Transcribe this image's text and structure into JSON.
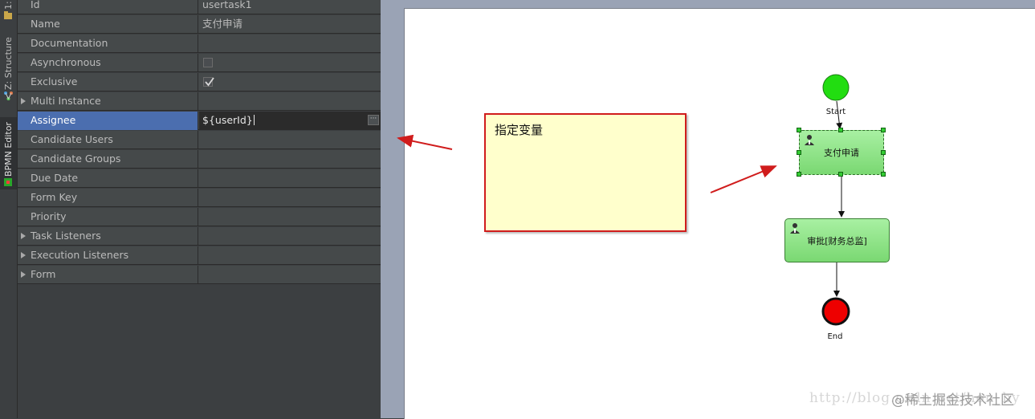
{
  "toolstrip": {
    "tabs": [
      {
        "label": "1:"
      },
      {
        "label": "Z: Structure"
      },
      {
        "label": "BPMN Editor"
      }
    ]
  },
  "properties": {
    "rows": [
      {
        "name": "Id",
        "value": "usertask1"
      },
      {
        "name": "Name",
        "value": "支付申请"
      },
      {
        "name": "Documentation",
        "value": ""
      },
      {
        "name": "Asynchronous",
        "value": ""
      },
      {
        "name": "Exclusive",
        "value": ""
      },
      {
        "name": "Multi Instance",
        "value": ""
      },
      {
        "name": "Assignee",
        "value": "${userId}"
      },
      {
        "name": "Candidate Users",
        "value": ""
      },
      {
        "name": "Candidate Groups",
        "value": ""
      },
      {
        "name": "Due Date",
        "value": ""
      },
      {
        "name": "Form Key",
        "value": ""
      },
      {
        "name": "Priority",
        "value": ""
      },
      {
        "name": "Task Listeners",
        "value": ""
      },
      {
        "name": "Execution Listeners",
        "value": ""
      },
      {
        "name": "Form",
        "value": ""
      }
    ],
    "asynchronous_checked": false,
    "exclusive_checked": true,
    "ellipsis_label": "···"
  },
  "annotation": {
    "text": "指定变量"
  },
  "diagram": {
    "start_label": "Start",
    "task1_label": "支付申请",
    "task2_label": "审批[财务总监]",
    "end_label": "End"
  },
  "watermark": {
    "url": "http://blog.csdn.net/hon_by",
    "site": "@稀土掘金技术社区"
  },
  "colors": {
    "start_event": "#22dd11",
    "end_event": "#ee0000",
    "task_fill": "#8fe388",
    "selection": "#4b6eaf",
    "arrow_red": "#d01c1c"
  }
}
